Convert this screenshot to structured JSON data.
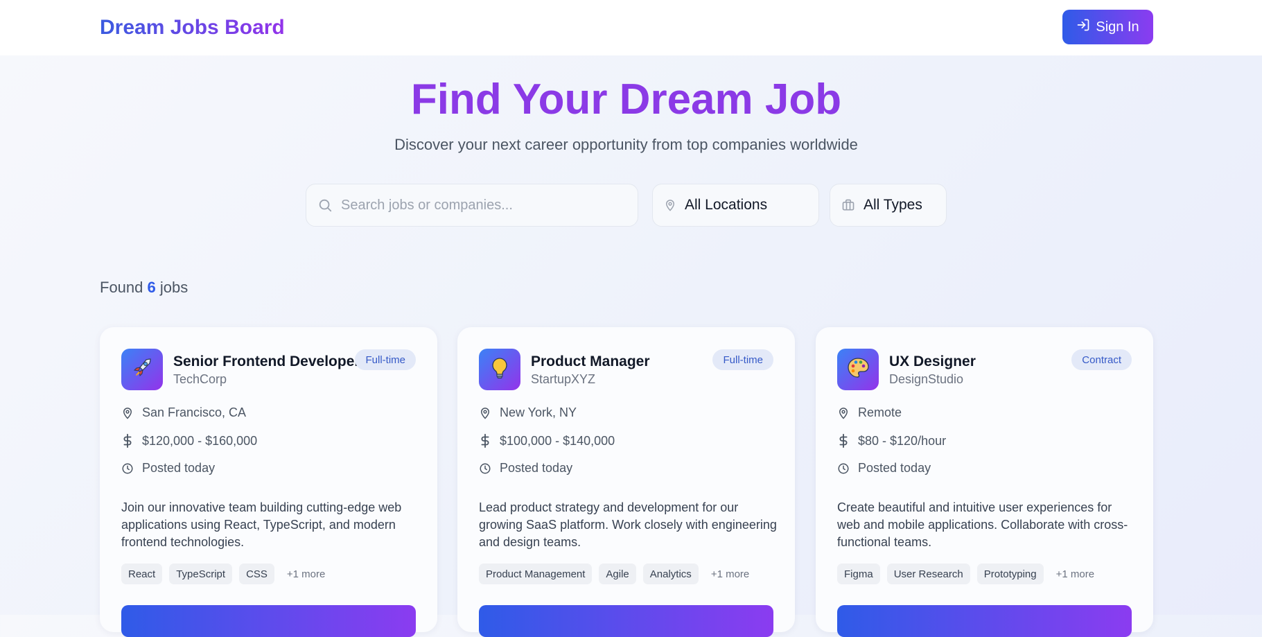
{
  "header": {
    "brand": "Dream Jobs Board",
    "sign_in_label": "Sign In"
  },
  "hero": {
    "title": "Find Your Dream Job",
    "subtitle": "Discover your next career opportunity from top companies worldwide"
  },
  "search": {
    "placeholder": "Search jobs or companies...",
    "value": "",
    "location": "All Locations",
    "type": "All Types"
  },
  "results": {
    "prefix": "Found",
    "count": "6",
    "suffix": "jobs"
  },
  "jobs": [
    {
      "logo_icon": "rocket-icon",
      "title": "Senior Frontend Developer",
      "company": "TechCorp",
      "badge": "Full-time",
      "location": "San Francisco, CA",
      "salary": "$120,000 - $160,000",
      "posted": "Posted today",
      "description": "Join our innovative team building cutting-edge web applications using React, TypeScript, and modern frontend technologies.",
      "tags": [
        "React",
        "TypeScript",
        "CSS"
      ],
      "more": "+1 more"
    },
    {
      "logo_icon": "lightbulb-icon",
      "title": "Product Manager",
      "company": "StartupXYZ",
      "badge": "Full-time",
      "location": "New York, NY",
      "salary": "$100,000 - $140,000",
      "posted": "Posted today",
      "description": "Lead product strategy and development for our growing SaaS platform. Work closely with engineering and design teams.",
      "tags": [
        "Product Management",
        "Agile",
        "Analytics"
      ],
      "more": "+1 more"
    },
    {
      "logo_icon": "palette-icon",
      "title": "UX Designer",
      "company": "DesignStudio",
      "badge": "Contract",
      "location": "Remote",
      "salary": "$80 - $120/hour",
      "posted": "Posted today",
      "description": "Create beautiful and intuitive user experiences for web and mobile applications. Collaborate with cross-functional teams.",
      "tags": [
        "Figma",
        "User Research",
        "Prototyping"
      ],
      "more": "+1 more"
    }
  ],
  "colors": {
    "accent_start": "#2f5be8",
    "accent_end": "#8b3cf0",
    "badge_bg": "#e3e9f8",
    "badge_text": "#3559c7"
  }
}
